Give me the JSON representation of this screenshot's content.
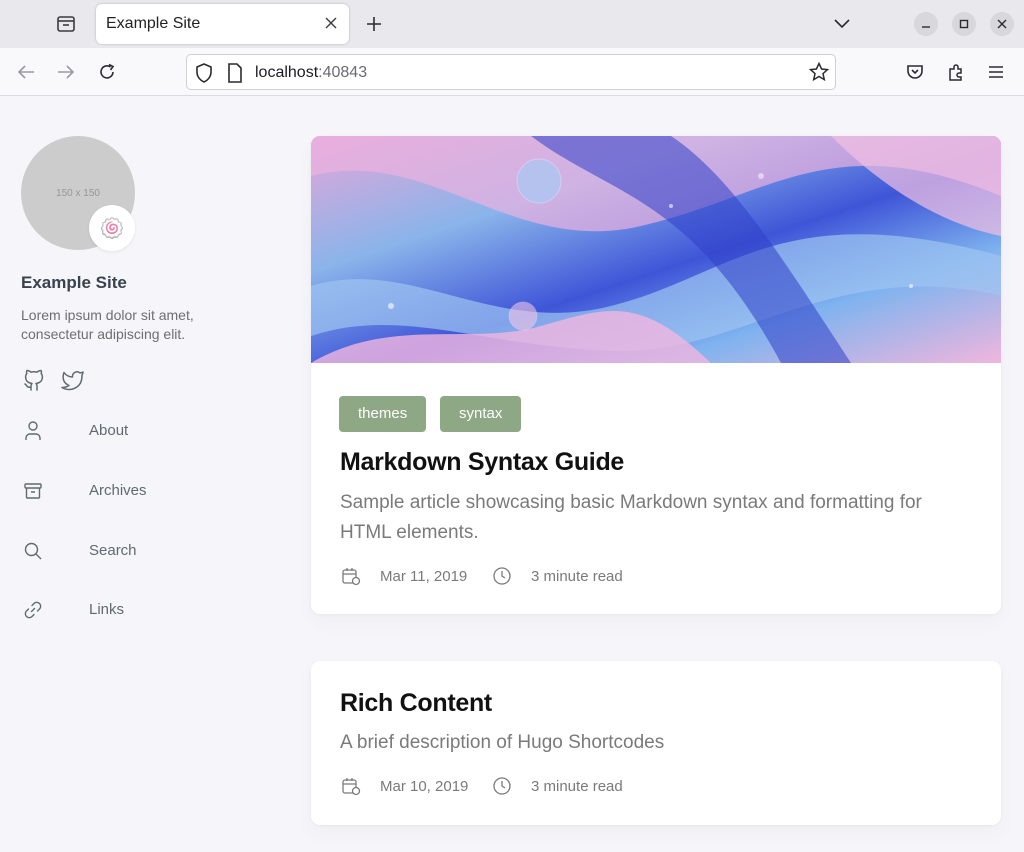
{
  "browser": {
    "tab_title": "Example Site",
    "url_host": "localhost",
    "url_port": ":40843"
  },
  "sidebar": {
    "avatar_placeholder": "150 x 150",
    "avatar_emoji": "🍥",
    "site_name": "Example Site",
    "site_description": "Lorem ipsum dolor sit amet, consectetur adipiscing elit.",
    "social": [
      "github-icon",
      "twitter-icon"
    ],
    "menu": [
      {
        "label": "About",
        "icon": "user-icon"
      },
      {
        "label": "Archives",
        "icon": "archive-icon"
      },
      {
        "label": "Search",
        "icon": "search-icon"
      },
      {
        "label": "Links",
        "icon": "link-icon"
      }
    ]
  },
  "posts": [
    {
      "tags": [
        "themes",
        "syntax"
      ],
      "title": "Markdown Syntax Guide",
      "description": "Sample article showcasing basic Markdown syntax and formatting for HTML elements.",
      "date": "Mar 11, 2019",
      "read_time": "3 minute read"
    },
    {
      "title": "Rich Content",
      "description": "A brief description of Hugo Shortcodes",
      "date": "Mar 10, 2019",
      "read_time": "3 minute read"
    }
  ],
  "colors": {
    "tag_bg": "#8ea885",
    "page_bg": "#f5f5fa"
  }
}
